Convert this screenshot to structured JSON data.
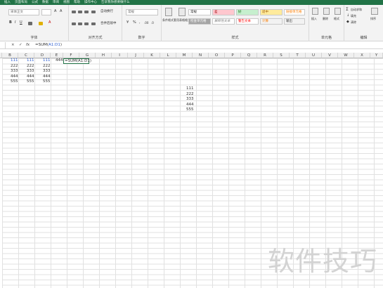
{
  "ribbon_tabs": [
    "插入",
    "页面布局",
    "公式",
    "数据",
    "审阅",
    "视图",
    "帮助",
    "操作中心",
    "告诉我你想要做什么"
  ],
  "ribbon": {
    "font": {
      "font_name": "宋体正文",
      "group_label": "字体"
    },
    "alignment": {
      "wrap_text": "自动换行",
      "merge": "合并后居中",
      "group_label": "对齐方式"
    },
    "number": {
      "format": "常规",
      "percent": "%",
      "group_label": "数字"
    },
    "styles": {
      "cond_format": "条件格式",
      "table_format": "套用表格格式",
      "cells": [
        "常规",
        "差",
        "好",
        "适中",
        "检查单元格",
        "解释性文本",
        "警告文本",
        "计算",
        "链接单元格",
        "输出"
      ],
      "group_label": "样式"
    },
    "cells_group": {
      "insert": "插入",
      "delete": "删除",
      "format": "格式",
      "group_label": "单元格"
    },
    "editing": {
      "autosum": "自动求和",
      "fill": "填充",
      "clear": "清除",
      "sort": "排序",
      "group_label": "编辑"
    }
  },
  "formula_bar": {
    "cancel": "×",
    "enter": "✓",
    "fx": "fx",
    "formula_prefix": "=SUM(",
    "formula_ref": "A1:D1",
    "formula_suffix": ")"
  },
  "columns": [
    "B",
    "C",
    "D",
    "E",
    "F",
    "G",
    "H",
    "I",
    "J",
    "K",
    "L",
    "M",
    "N",
    "O",
    "P",
    "Q",
    "R",
    "S",
    "T",
    "U",
    "V",
    "W",
    "X",
    "Y"
  ],
  "rows": [
    [
      "111",
      "111",
      "111"
    ],
    [
      "222",
      "222",
      "222"
    ],
    [
      "333",
      "333",
      "333"
    ],
    [
      "444",
      "444",
      "444"
    ],
    [
      "555",
      "555",
      "555"
    ]
  ],
  "e1_value": "444",
  "active_cell_text": "=SUM(A1:D1)",
  "m_column_values": [
    "111",
    "222",
    "333",
    "444",
    "555"
  ],
  "watermark": "软件技巧"
}
